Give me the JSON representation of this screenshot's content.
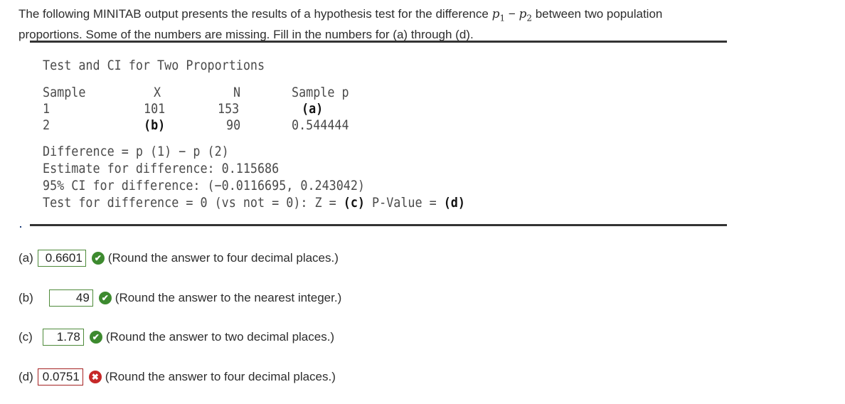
{
  "intro": {
    "line1_before": "The following MINITAB output presents the results of a hypothesis test for the difference ",
    "p1": "p",
    "p1_sub": "1",
    "minus": " − ",
    "p2": "p",
    "p2_sub": "2",
    "line1_after": " between two population",
    "line2": "proportions. Some of the numbers are missing. Fill in the numbers for (a) through (d)."
  },
  "output": {
    "title": "Test and CI for Two Proportions",
    "headers": [
      "Sample",
      "X",
      "N",
      "Sample p"
    ],
    "rows": [
      {
        "sample": "1",
        "x": "101",
        "n": "153",
        "p": "(a)"
      },
      {
        "sample": "2",
        "x": "(b)",
        "n": "90",
        "p": "0.544444"
      }
    ],
    "difference": "Difference = p (1) − p (2)",
    "estimate": "Estimate for difference: 0.115686",
    "ci": "95% CI for difference: (−0.0116695, 0.243042)",
    "test_prefix": "Test for difference = 0 (vs not = 0): Z = ",
    "test_z": "(c)",
    "test_mid": " P-Value = ",
    "test_p": "(d)"
  },
  "answers": [
    {
      "label": "(a)",
      "value": "0.6601",
      "status": "correct",
      "icon": "check-icon",
      "hint": "(Round the answer to four decimal places.)"
    },
    {
      "label": "(b)",
      "value": "49",
      "status": "correct",
      "icon": "check-icon",
      "hint": "(Round the answer to the nearest integer.)"
    },
    {
      "label": "(c)",
      "value": "1.78",
      "status": "correct",
      "icon": "check-icon",
      "hint": "(Round the answer to two decimal places.)"
    },
    {
      "label": "(d)",
      "value": "0.0751",
      "status": "incorrect",
      "icon": "x-icon",
      "hint": "(Round the answer to four decimal places.)"
    }
  ],
  "colors": {
    "correct": "#3d8a2f",
    "incorrect": "#c62828"
  }
}
